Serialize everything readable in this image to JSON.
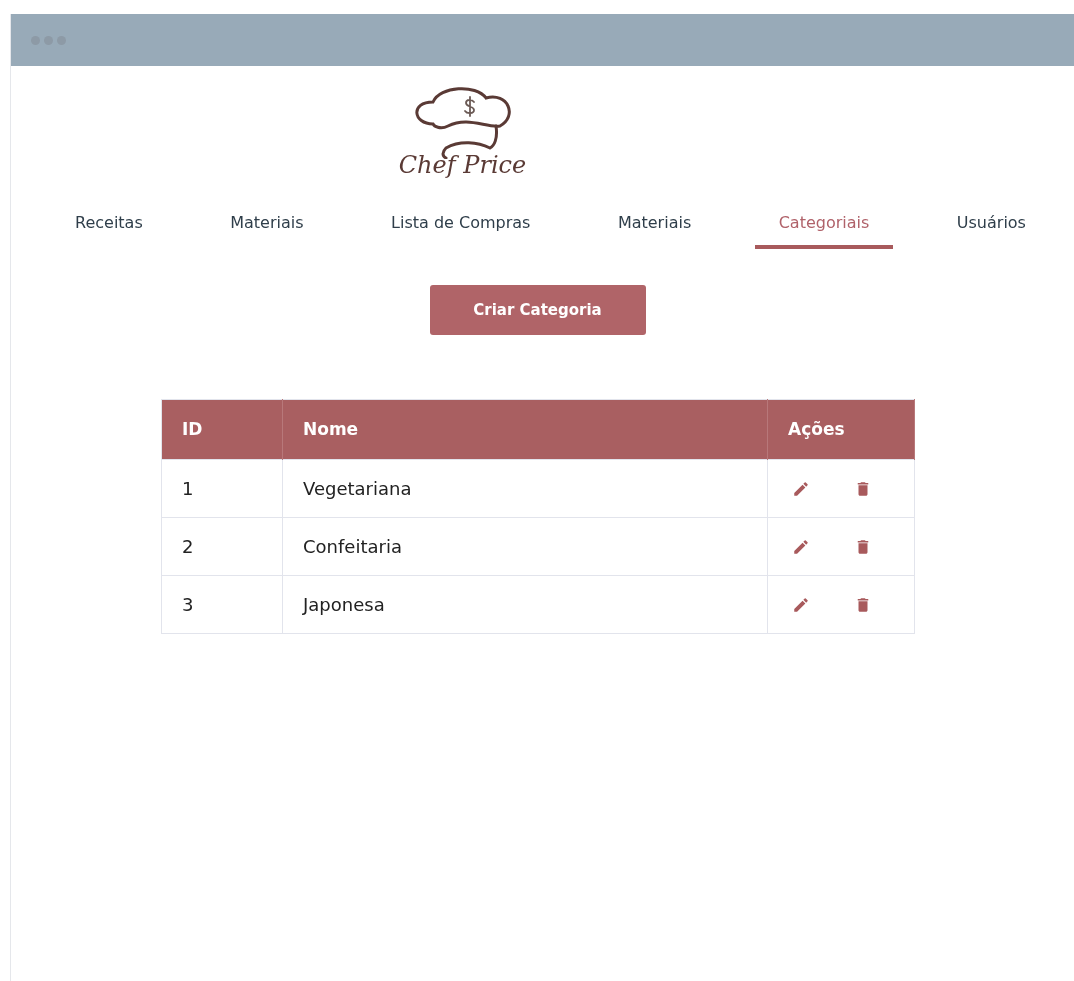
{
  "logo": {
    "text": "Chef Price"
  },
  "tabs": [
    {
      "label": "Receitas",
      "selected": false
    },
    {
      "label": "Materiais",
      "selected": false
    },
    {
      "label": "Lista de Compras",
      "selected": false
    },
    {
      "label": "Materiais",
      "selected": false
    },
    {
      "label": "Categoriais",
      "selected": true
    },
    {
      "label": "Usuários",
      "selected": false
    }
  ],
  "create_button": "Criar Categoria",
  "table": {
    "columns": [
      "ID",
      "Nome",
      "Ações"
    ],
    "rows": [
      {
        "id": "1",
        "name": "Vegetariana"
      },
      {
        "id": "2",
        "name": "Confeitaria"
      },
      {
        "id": "3",
        "name": "Japonesa"
      }
    ]
  }
}
